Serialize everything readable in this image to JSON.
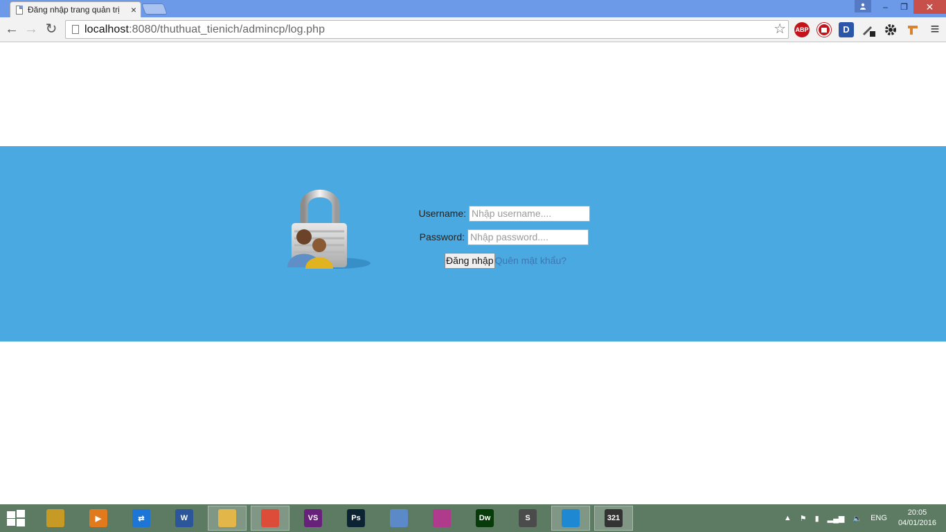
{
  "browser": {
    "tab_title": "Đăng nhập trang quản trị",
    "tab_close": "×",
    "url_host": "localhost",
    "url_path": ":8080/thuthuat_tienich/admincp/log.php",
    "window_minimize": "–",
    "window_restore": "❐",
    "window_close": "✕"
  },
  "toolbar": {
    "back": "←",
    "forward": "→",
    "reload": "↻",
    "star": "☆",
    "menu": "≡",
    "extensions": [
      {
        "name": "adblock-plus-icon",
        "label": "ABP",
        "color": "#c3141b"
      },
      {
        "name": "stop-icon",
        "label": "",
        "color": "#c3141b"
      },
      {
        "name": "d-extension-icon",
        "label": "D",
        "color": "#2a55a8"
      }
    ]
  },
  "login": {
    "username_label": "Username:",
    "username_placeholder": "Nhập username....",
    "password_label": "Password:",
    "password_placeholder": "Nhập password....",
    "submit_label": "Đăng nhập",
    "forgot_label": "Quên mật khẩu?"
  },
  "taskbar": {
    "apps": [
      {
        "name": "system-tools-icon",
        "label": "",
        "color": "#c79a25"
      },
      {
        "name": "media-player-icon",
        "label": "▶",
        "color": "#e07a1d"
      },
      {
        "name": "teamviewer-icon",
        "label": "⇄",
        "color": "#1d76d6"
      },
      {
        "name": "word-icon",
        "label": "W",
        "color": "#2b579a"
      },
      {
        "name": "file-explorer-icon",
        "label": "",
        "color": "#e3b64a"
      },
      {
        "name": "chrome-icon",
        "label": "",
        "color": "#dd4b39"
      },
      {
        "name": "visual-studio-icon",
        "label": "VS",
        "color": "#68217a"
      },
      {
        "name": "photoshop-icon",
        "label": "Ps",
        "color": "#0b2333"
      },
      {
        "name": "virtualbox-icon",
        "label": "",
        "color": "#5c89c7"
      },
      {
        "name": "feather-icon",
        "label": "",
        "color": "#b03a8c"
      },
      {
        "name": "dreamweaver-icon",
        "label": "Dw",
        "color": "#073b09"
      },
      {
        "name": "sublime-icon",
        "label": "S",
        "color": "#4b4b4b"
      },
      {
        "name": "vmware-icon",
        "label": "",
        "color": "#1e88d2"
      },
      {
        "name": "media-player-classic-icon",
        "label": "321",
        "color": "#333333"
      }
    ],
    "language": "ENG",
    "time": "20:05",
    "date": "04/01/2016"
  }
}
